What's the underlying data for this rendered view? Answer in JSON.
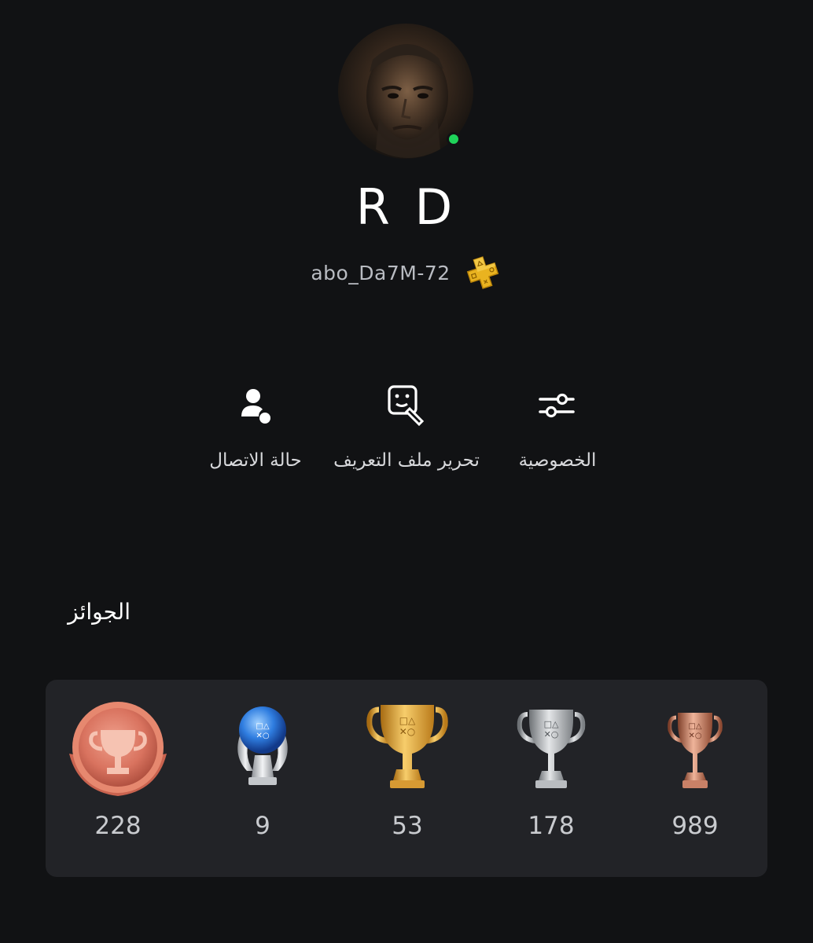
{
  "profile": {
    "display_name": "R D",
    "online_id": "abo_Da7M-72",
    "online_status": "online",
    "status_color": "#1fd35a",
    "avatar_icon": "avatar-portrait",
    "membership_icon": "playstation-plus-icon"
  },
  "actions": [
    {
      "label": "حالة الاتصال",
      "icon": "person-status-icon"
    },
    {
      "label": "تحرير ملف التعريف",
      "icon": "edit-profile-icon"
    },
    {
      "label": "الخصوصية",
      "icon": "sliders-icon"
    }
  ],
  "trophies": {
    "title": "الجوائز",
    "level": {
      "value": "228",
      "icon": "trophy-level-icon"
    },
    "platinum": {
      "value": "9",
      "icon": "platinum-trophy-icon"
    },
    "gold": {
      "value": "53",
      "icon": "gold-trophy-icon"
    },
    "silver": {
      "value": "178",
      "icon": "silver-trophy-icon"
    },
    "bronze": {
      "value": "989",
      "icon": "bronze-trophy-icon"
    }
  },
  "colors": {
    "background": "#111214",
    "card": "#222327",
    "gold": "#e2a33a",
    "silver": "#b9bcc0",
    "bronze": "#c98167",
    "level": "#d9735f",
    "platinum_blue": "#2f7de0"
  }
}
